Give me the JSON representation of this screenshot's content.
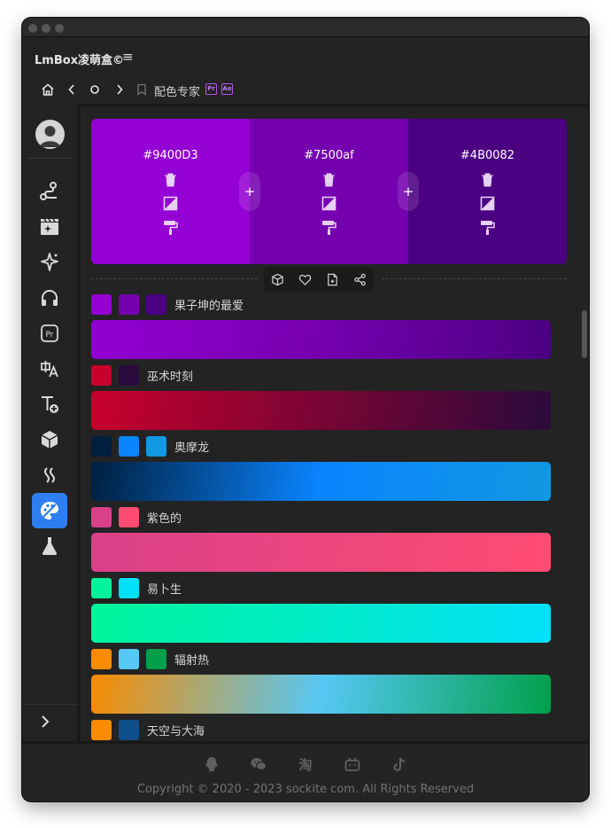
{
  "window": {
    "title_bar": ""
  },
  "app": {
    "title": "LmBox凌萌盒©",
    "menu_icon": "hamburger-icon"
  },
  "nav": {
    "page_title": "配色专家",
    "badges": [
      "Pr",
      "Ae"
    ]
  },
  "sidebar": {
    "items": [
      {
        "icon": "route-icon",
        "active": false
      },
      {
        "icon": "clapperboard-sparkle-icon",
        "active": false
      },
      {
        "icon": "sparkle-icon",
        "active": false
      },
      {
        "icon": "headphones-icon",
        "active": false
      },
      {
        "icon": "premiere-pr-icon",
        "label": "Pr",
        "active": false
      },
      {
        "icon": "translate-icon",
        "active": false
      },
      {
        "icon": "flow-add-icon",
        "active": false
      },
      {
        "icon": "cube-icon",
        "active": false
      },
      {
        "icon": "waves-icon",
        "active": false
      },
      {
        "icon": "palette-icon",
        "active": true
      },
      {
        "icon": "flask-icon",
        "active": false
      }
    ]
  },
  "palette": {
    "swatches": [
      {
        "hex": "#9400D3",
        "color": "#9400D3"
      },
      {
        "hex": "#7500af",
        "color": "#7500af"
      },
      {
        "hex": "#4B0082",
        "color": "#4B0082"
      }
    ],
    "add_label": "+"
  },
  "toolbar": {
    "buttons": [
      "cube-icon",
      "heart-icon",
      "file-add-icon",
      "share-icon"
    ]
  },
  "schemes": [
    {
      "name": "果子坤的最爱",
      "colors": [
        "#9400D3",
        "#7500af",
        "#4B0082"
      ]
    },
    {
      "name": "巫术时刻",
      "colors": [
        "#c8002c",
        "#2a0a3c"
      ]
    },
    {
      "name": "奥摩龙",
      "colors": [
        "#001f3f",
        "#0a84ff",
        "#1098e0"
      ]
    },
    {
      "name": "紫色的",
      "colors": [
        "#d9408a",
        "#ff4c72"
      ]
    },
    {
      "name": "易卜生",
      "colors": [
        "#00f59a",
        "#00e0f8"
      ]
    },
    {
      "name": "辐射热",
      "colors": [
        "#f88b00",
        "#56c8f5",
        "#00a04a"
      ]
    },
    {
      "name": "天空与大海",
      "colors": [
        "#f88b00",
        "#0f4f8c"
      ]
    }
  ],
  "footer": {
    "icons": [
      "qq-icon",
      "wechat-icon",
      "taobao-icon",
      "bilibili-icon",
      "tiktok-icon"
    ],
    "taobao_label": "淘",
    "copyright": "Copyright © 2020 - 2023 sockite com. All Rights Reserved"
  }
}
